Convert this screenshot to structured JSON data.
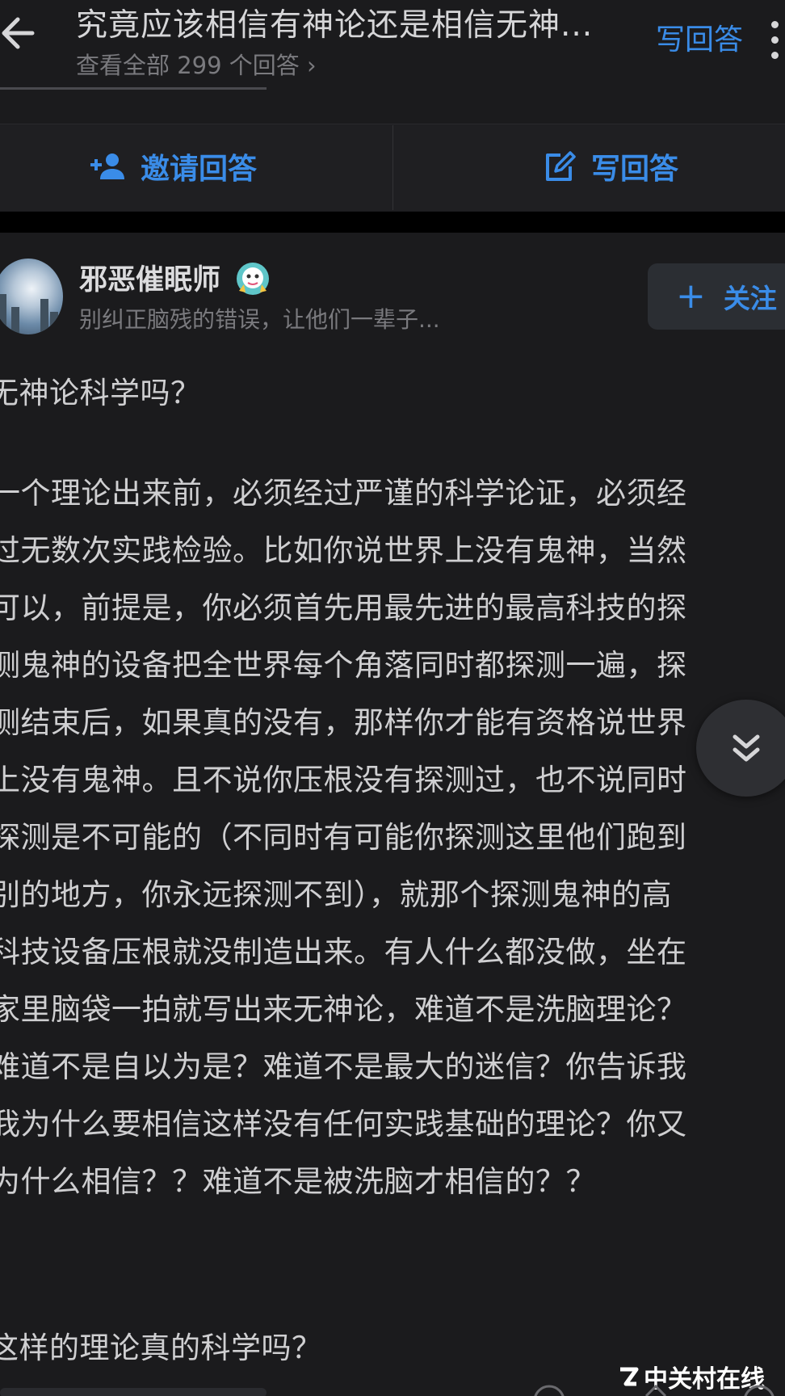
{
  "header": {
    "question_title": "究竟应该相信有神论还是相信无神...",
    "view_all": "查看全部 299 个回答 ›",
    "write_answer": "写回答"
  },
  "actions": {
    "invite": "邀请回答",
    "write": "写回答"
  },
  "answer": {
    "author": "邪恶催眠师",
    "bio": "别纠正脑残的错误，让他们一辈子...",
    "follow_label": "关注",
    "follow_plus": "+",
    "paragraph_1": "无神论科学吗？",
    "body_lines": [
      "一个理论出来前，必须经过严谨的科学论证，必须经",
      "过无数次实践检验。比如你说世界上没有鬼神，当然",
      "可以，前提是，你必须首先用最先进的最高科技的探",
      "测鬼神的设备把全世界每个角落同时都探测一遍，探",
      "测结束后，如果真的没有，那样你才能有资格说世界",
      "上没有鬼神。且不说你压根没有探测过，也不说同时",
      "探测是不可能的（不同时有可能你探测这里他们跑到",
      "别的地方，你永远探测不到），就那个探测鬼神的高",
      "科技设备压根就没制造出来。有人什么都没做，坐在",
      "家里脑袋一拍就写出来无神论，难道不是洗脑理论？",
      "难道不是自以为是？难道不是最大的迷信？你告诉我",
      "我为什么要相信这样没有任何实践基础的理论？你又",
      "为什么相信？？难道不是被洗脑才相信的？？"
    ],
    "paragraph_last": "这样的理论真的科学吗？"
  },
  "watermark": "中关村在线",
  "colors": {
    "background": "#1b1b1d",
    "accent": "#3a8ce8",
    "text": "#cfcfd1",
    "muted": "#7a7a7e"
  },
  "icons": [
    "back-arrow-icon",
    "more-vertical-icon",
    "add-person-icon",
    "edit-icon",
    "plus-icon",
    "double-chevron-down-icon",
    "verified-badge-icon"
  ]
}
